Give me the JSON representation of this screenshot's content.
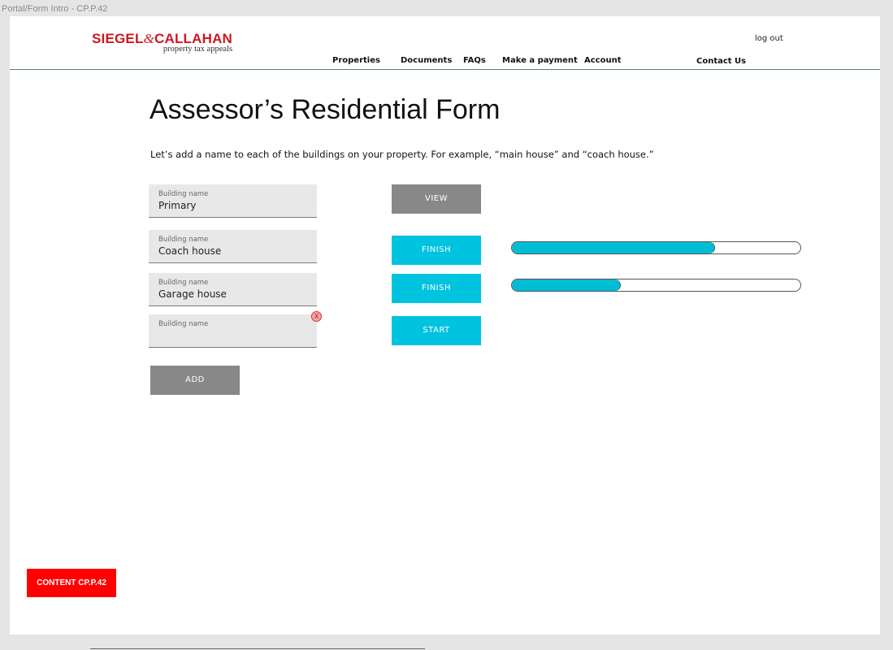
{
  "frame_label": "Portal/Form Intro  - CP.P.42",
  "logo": {
    "main_left": "SIEGEL",
    "amp": "&",
    "main_right": "CALLAHAN",
    "sub": "property tax appeals"
  },
  "header": {
    "logout": "log out",
    "nav": [
      "Properties",
      "Documents",
      "FAQs",
      "Make a payment",
      "Account"
    ],
    "active_nav": "Properties",
    "contact": "Contact Us"
  },
  "page": {
    "title": "Assessor’s Residential Form",
    "intro": "Let’s add a name to each of the buildings on your property. For example, “main house” and “coach house.”"
  },
  "buildings": [
    {
      "label": "Building name",
      "value": "Primary",
      "action": "VIEW",
      "progress": null
    },
    {
      "label": "Building name",
      "value": "Coach house",
      "action": "FINISH",
      "progress": 0.7
    },
    {
      "label": "Building name",
      "value": "Garage house",
      "action": "FINISH",
      "progress": 0.375
    },
    {
      "label": "Building name",
      "value": "",
      "action": "START",
      "progress": null
    }
  ],
  "clear_icon": "X",
  "add_button": "ADD",
  "content_tag": "CONTENT CP.P.42",
  "colors": {
    "brand_red": "#d0161d",
    "accent_cyan": "#00c3e0",
    "button_gray": "#888888",
    "tag_red": "#ff0000"
  }
}
